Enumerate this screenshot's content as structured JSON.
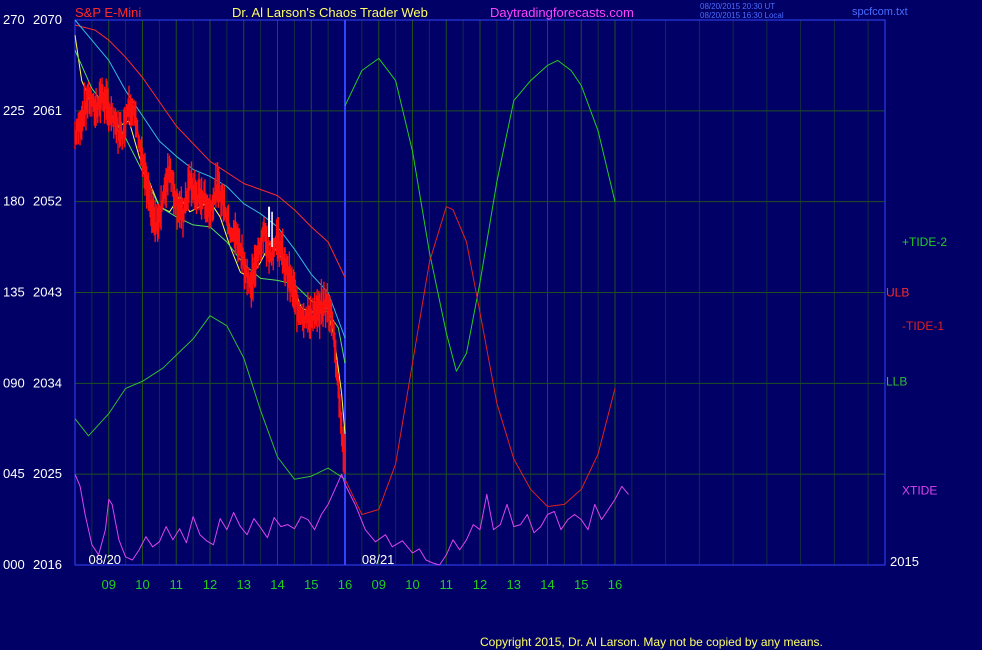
{
  "header": {
    "symbol": "S&P E-Mini",
    "title": "Dr. Al Larson's Chaos Trader Web",
    "site": "Daytradingforecasts.com",
    "stamp1": "08/20/2015 20:30 UT",
    "stamp2": "08/20/2015 16:30 Local",
    "file": "spcfcom.txt"
  },
  "colors": {
    "background": "#000066",
    "grid": "#1f4f1f",
    "axis_text": "#ffffff",
    "symbol": "#ff2a2a",
    "title": "#ffff66",
    "site": "#ff44ff",
    "stamp": "#4a6dff",
    "time_ticks": "#22cc22",
    "divider": "#3344ff",
    "copyright": "#ffff66"
  },
  "footer": {
    "copyright": "Copyright 2015, Dr. Al Larson. May not be copied by any means."
  },
  "chart_data": {
    "type": "line",
    "title": "S&P E-Mini",
    "left_axis_values": [
      "270",
      "225",
      "180",
      "135",
      "090",
      "045",
      "000"
    ],
    "price_axis_values": [
      "2070",
      "2061",
      "2052",
      "2043",
      "2034",
      "2025",
      "2016"
    ],
    "ylim": [
      2016,
      2070
    ],
    "xlim": [
      8,
      32
    ],
    "x_tick_labels": [
      "09",
      "10",
      "11",
      "12",
      "13",
      "14",
      "15",
      "16",
      "09",
      "10",
      "11",
      "12",
      "13",
      "14",
      "15",
      "16"
    ],
    "x_tick_positions": [
      9,
      10,
      11,
      12,
      13,
      14,
      15,
      16,
      17,
      18,
      19,
      20,
      21,
      22,
      23,
      24
    ],
    "date_labels": [
      {
        "text": "08/20",
        "x": 8.4
      },
      {
        "text": "08/21",
        "x": 16.5
      }
    ],
    "year_label": "2015",
    "divider_x": 16,
    "series": [
      {
        "name": "+TIDE-2",
        "color": "#22cc22",
        "points": [
          [
            16,
            2061.5
          ],
          [
            16.5,
            2065
          ],
          [
            17,
            2066.2
          ],
          [
            17.5,
            2064
          ],
          [
            18,
            2057
          ],
          [
            18.5,
            2047
          ],
          [
            19,
            2039
          ],
          [
            19.3,
            2035.2
          ],
          [
            19.6,
            2037
          ],
          [
            20,
            2044
          ],
          [
            20.5,
            2054
          ],
          [
            21,
            2062
          ],
          [
            21.5,
            2064
          ],
          [
            22,
            2065.5
          ],
          [
            22.3,
            2066
          ],
          [
            22.7,
            2065
          ],
          [
            23,
            2063.5
          ],
          [
            23.5,
            2059
          ],
          [
            24,
            2052
          ]
        ]
      },
      {
        "name": "ULB",
        "color": "#ff2a2a",
        "points": [
          [
            8,
            2069.5
          ],
          [
            8.6,
            2069
          ],
          [
            9,
            2068
          ],
          [
            9.5,
            2066.3
          ],
          [
            10,
            2064.3
          ],
          [
            11,
            2059.5
          ],
          [
            12,
            2056
          ],
          [
            13,
            2053.8
          ],
          [
            14,
            2052.6
          ],
          [
            14.5,
            2051.2
          ],
          [
            15,
            2049.5
          ],
          [
            15.5,
            2048
          ],
          [
            16,
            2044.5
          ]
        ]
      },
      {
        "name": "-TIDE-1",
        "color": "#dd2222",
        "points": [
          [
            16,
            2024.5
          ],
          [
            16.5,
            2021
          ],
          [
            17,
            2021.5
          ],
          [
            17.5,
            2026
          ],
          [
            18,
            2036
          ],
          [
            18.5,
            2046
          ],
          [
            19,
            2051.5
          ],
          [
            19.2,
            2051.2
          ],
          [
            19.6,
            2048
          ],
          [
            20,
            2041
          ],
          [
            20.5,
            2032
          ],
          [
            21,
            2026.5
          ],
          [
            21.5,
            2023.5
          ],
          [
            22,
            2021.8
          ],
          [
            22.5,
            2022
          ],
          [
            23,
            2023.5
          ],
          [
            23.5,
            2027
          ],
          [
            24,
            2033.5
          ]
        ]
      },
      {
        "name": "LLB",
        "color": "#33bb33",
        "points": [
          [
            8,
            2030.5
          ],
          [
            8.4,
            2028.8
          ],
          [
            9,
            2031
          ],
          [
            9.5,
            2033.5
          ],
          [
            10,
            2034.2
          ],
          [
            10.6,
            2035.5
          ],
          [
            11,
            2036.8
          ],
          [
            11.5,
            2038.4
          ],
          [
            12,
            2040.7
          ],
          [
            12.5,
            2039.7
          ],
          [
            13,
            2036.5
          ],
          [
            13.5,
            2031.3
          ],
          [
            14,
            2026.7
          ],
          [
            14.5,
            2024.5
          ],
          [
            15,
            2024.8
          ],
          [
            15.5,
            2025.6
          ],
          [
            16,
            2024.5
          ]
        ]
      },
      {
        "name": "XTIDE",
        "color": "#dd44ee",
        "points": [
          [
            8,
            2025
          ],
          [
            8.15,
            2023.8
          ],
          [
            8.3,
            2021
          ],
          [
            8.5,
            2018
          ],
          [
            8.7,
            2017
          ],
          [
            8.9,
            2019.5
          ],
          [
            9,
            2022.5
          ],
          [
            9.1,
            2022
          ],
          [
            9.3,
            2018.5
          ],
          [
            9.5,
            2016.8
          ],
          [
            9.7,
            2016.5
          ],
          [
            9.9,
            2017.5
          ],
          [
            10.1,
            2018.8
          ],
          [
            10.3,
            2017.8
          ],
          [
            10.5,
            2018.3
          ],
          [
            10.7,
            2019.8
          ],
          [
            10.9,
            2018.5
          ],
          [
            11.1,
            2019.6
          ],
          [
            11.3,
            2018.2
          ],
          [
            11.5,
            2020.8
          ],
          [
            11.7,
            2019
          ],
          [
            11.9,
            2018.4
          ],
          [
            12.1,
            2018
          ],
          [
            12.3,
            2020.6
          ],
          [
            12.5,
            2019.5
          ],
          [
            12.7,
            2021.2
          ],
          [
            12.9,
            2019.8
          ],
          [
            13.1,
            2019
          ],
          [
            13.3,
            2020.6
          ],
          [
            13.5,
            2019.7
          ],
          [
            13.7,
            2018.7
          ],
          [
            13.9,
            2020.7
          ],
          [
            14.1,
            2019.8
          ],
          [
            14.3,
            2020
          ],
          [
            14.5,
            2019.6
          ],
          [
            14.7,
            2020.8
          ],
          [
            14.9,
            2020.5
          ],
          [
            15.1,
            2019.5
          ],
          [
            15.3,
            2021
          ],
          [
            15.5,
            2022
          ],
          [
            15.7,
            2023.5
          ],
          [
            15.9,
            2025
          ],
          [
            16,
            2024
          ],
          [
            16.3,
            2022
          ],
          [
            16.6,
            2019.5
          ],
          [
            16.9,
            2018.3
          ],
          [
            17.2,
            2019
          ],
          [
            17.4,
            2017.8
          ],
          [
            17.7,
            2018.4
          ],
          [
            18,
            2017.2
          ],
          [
            18.2,
            2017.6
          ],
          [
            18.4,
            2016.5
          ],
          [
            18.6,
            2016.2
          ],
          [
            18.8,
            2016
          ],
          [
            19.0,
            2017
          ],
          [
            19.2,
            2018.5
          ],
          [
            19.4,
            2017.5
          ],
          [
            19.6,
            2018.5
          ],
          [
            19.8,
            2020
          ],
          [
            20,
            2019.5
          ],
          [
            20.2,
            2023
          ],
          [
            20.4,
            2019.5
          ],
          [
            20.6,
            2020
          ],
          [
            20.8,
            2022
          ],
          [
            21.0,
            2019.8
          ],
          [
            21.2,
            2020
          ],
          [
            21.4,
            2021
          ],
          [
            21.6,
            2019.2
          ],
          [
            21.8,
            2019.8
          ],
          [
            22,
            2021
          ],
          [
            22.2,
            2021.3
          ],
          [
            22.4,
            2019.5
          ],
          [
            22.6,
            2020.5
          ],
          [
            22.8,
            2021
          ],
          [
            23,
            2020.5
          ],
          [
            23.2,
            2019.5
          ],
          [
            23.4,
            2022
          ],
          [
            23.6,
            2020.5
          ],
          [
            23.8,
            2021.5
          ],
          [
            24,
            2022.5
          ],
          [
            24.2,
            2023.8
          ],
          [
            24.4,
            2023
          ]
        ]
      },
      {
        "name": "Price",
        "color": "#ff1111",
        "points": [
          [
            8,
            2058.5
          ],
          [
            8.2,
            2060.2
          ],
          [
            8.4,
            2062.5
          ],
          [
            8.6,
            2061
          ],
          [
            8.8,
            2062.6
          ],
          [
            9,
            2061
          ],
          [
            9.2,
            2059.5
          ],
          [
            9.4,
            2058.5
          ],
          [
            9.6,
            2062
          ],
          [
            9.8,
            2060
          ],
          [
            10,
            2056
          ],
          [
            10.2,
            2052
          ],
          [
            10.4,
            2049.5
          ],
          [
            10.6,
            2052
          ],
          [
            10.8,
            2055.5
          ],
          [
            11,
            2052
          ],
          [
            11.2,
            2050.5
          ],
          [
            11.4,
            2054
          ],
          [
            11.6,
            2052.5
          ],
          [
            11.8,
            2052.5
          ],
          [
            12,
            2051
          ],
          [
            12.2,
            2053.5
          ],
          [
            12.4,
            2052
          ],
          [
            12.6,
            2049
          ],
          [
            12.8,
            2048.5
          ],
          [
            13,
            2046
          ],
          [
            13.2,
            2043.5
          ],
          [
            13.4,
            2046.5
          ],
          [
            13.6,
            2049
          ],
          [
            13.8,
            2046.5
          ],
          [
            14,
            2048.5
          ],
          [
            14.2,
            2046
          ],
          [
            14.4,
            2044
          ],
          [
            14.6,
            2041.5
          ],
          [
            14.8,
            2040.5
          ],
          [
            15,
            2040.5
          ],
          [
            15.2,
            2041
          ],
          [
            15.4,
            2042
          ],
          [
            15.6,
            2041
          ],
          [
            15.8,
            2034
          ],
          [
            15.9,
            2029
          ],
          [
            16,
            2027
          ]
        ]
      },
      {
        "name": "Average",
        "color": "#ffff44",
        "points": [
          [
            8,
            2068.5
          ],
          [
            8.2,
            2064
          ],
          [
            8.5,
            2061.5
          ],
          [
            8.8,
            2062
          ],
          [
            9,
            2061
          ],
          [
            9.3,
            2059.5
          ],
          [
            9.6,
            2060
          ],
          [
            9.9,
            2056.5
          ],
          [
            10.2,
            2054
          ],
          [
            10.5,
            2051.5
          ],
          [
            10.8,
            2051
          ],
          [
            11.1,
            2052.5
          ],
          [
            11.4,
            2051
          ],
          [
            11.7,
            2051.5
          ],
          [
            12,
            2052
          ],
          [
            12.3,
            2050.5
          ],
          [
            12.6,
            2047.5
          ],
          [
            12.9,
            2045
          ],
          [
            13.2,
            2044.5
          ],
          [
            13.5,
            2046
          ],
          [
            13.8,
            2048
          ],
          [
            14.1,
            2046.5
          ],
          [
            14.4,
            2044.5
          ],
          [
            14.7,
            2041.5
          ],
          [
            15,
            2041
          ],
          [
            15.3,
            2041.8
          ],
          [
            15.5,
            2041.3
          ],
          [
            15.7,
            2038
          ],
          [
            15.9,
            2033
          ],
          [
            16,
            2029
          ]
        ]
      },
      {
        "name": "Trend",
        "color": "#33bbdd",
        "points": [
          [
            8,
            2070
          ],
          [
            8.5,
            2068
          ],
          [
            9,
            2066
          ],
          [
            9.5,
            2063
          ],
          [
            10,
            2060.5
          ],
          [
            10.5,
            2058
          ],
          [
            11,
            2056.5
          ],
          [
            11.5,
            2055.2
          ],
          [
            12,
            2054.5
          ],
          [
            12.5,
            2053.5
          ],
          [
            13,
            2051.8
          ],
          [
            13.5,
            2050.8
          ],
          [
            14,
            2049.5
          ],
          [
            14.5,
            2047.3
          ],
          [
            15,
            2044.8
          ],
          [
            15.5,
            2043
          ],
          [
            16,
            2038.5
          ]
        ]
      },
      {
        "name": "Base",
        "color": "#55dd55",
        "points": [
          [
            8,
            2067
          ],
          [
            8.5,
            2063.2
          ],
          [
            9,
            2061
          ],
          [
            9.5,
            2058.3
          ],
          [
            10,
            2055
          ],
          [
            10.5,
            2051.5
          ],
          [
            11,
            2050.5
          ],
          [
            11.5,
            2049.7
          ],
          [
            12,
            2049.5
          ],
          [
            12.5,
            2048
          ],
          [
            13,
            2045.8
          ],
          [
            13.5,
            2044.4
          ],
          [
            14,
            2044.2
          ],
          [
            14.5,
            2043.8
          ],
          [
            15,
            2042.2
          ],
          [
            15.5,
            2041
          ],
          [
            15.8,
            2039.5
          ],
          [
            16,
            2036
          ]
        ]
      }
    ],
    "series_labels": [
      {
        "text": "+TIDE-2",
        "color": "#22cc22"
      },
      {
        "text": "ULB",
        "color": "#ff2a2a"
      },
      {
        "text": "-TIDE-1",
        "color": "#dd2222"
      },
      {
        "text": "LLB",
        "color": "#33bb33"
      },
      {
        "text": "XTIDE",
        "color": "#dd44ee"
      }
    ]
  }
}
